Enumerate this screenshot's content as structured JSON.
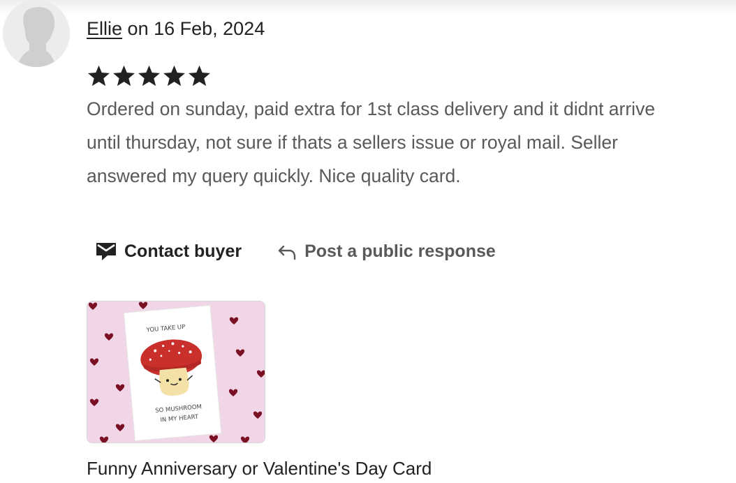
{
  "review": {
    "reviewer_name": "Ellie",
    "date_text": "on 16 Feb, 2024",
    "rating": 5,
    "rating_max": 5,
    "text_lines": [
      "Ordered on sunday, paid extra for 1st class delivery and it didnt arrive",
      "until thursday, not sure if thats a sellers issue or royal mail. Seller",
      "answered my query quickly. Nice quality card."
    ]
  },
  "actions": {
    "contact_label": "Contact buyer",
    "public_response_label": "Post a public response"
  },
  "listing": {
    "title": "Funny Anniversary or Valentine's Day Card",
    "card_text_top": "YOU TAKE UP",
    "card_text_bottom_1": "SO MUSHROOM",
    "card_text_bottom_2": "IN MY HEART"
  },
  "icons": {
    "avatar": "default-user-icon",
    "star": "star-icon",
    "contact": "message-envelope-icon",
    "reply": "reply-arrow-icon"
  },
  "colors": {
    "text_primary": "#222222",
    "text_secondary": "#595959",
    "thumb_background": "#f0d6e6",
    "mushroom_cap": "#c9302c"
  }
}
